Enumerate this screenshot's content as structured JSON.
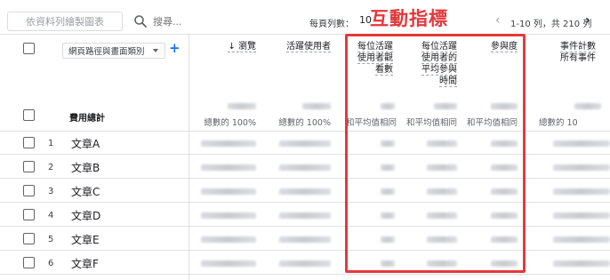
{
  "toolbar": {
    "chart_button_label": "依資料列繪製圖表",
    "search_placeholder": "搜尋...",
    "rows_per_page_label": "每頁列數：",
    "rows_per_page_value": "10",
    "pager_text": "1-10 列，共 210 列",
    "pager_prev": "‹",
    "pager_next": "›"
  },
  "annotation": {
    "title": "互動指標",
    "color": "#e5383b"
  },
  "dimension": {
    "selector_label": "網頁路徑與畫面類別",
    "add_symbol": "+"
  },
  "columns": [
    {
      "label": "↓ 瀏覽",
      "total_sub": "總數的 100%"
    },
    {
      "label": "活躍使用者",
      "total_sub": "總數的 100%"
    },
    {
      "label_lines": [
        "每位活躍",
        "使用者觀",
        "看數"
      ],
      "total_sub": "和平均值相同"
    },
    {
      "label_lines": [
        "每位活躍",
        "使用者的",
        "平均參與",
        "時間"
      ],
      "total_sub": "和平均值相同"
    },
    {
      "label": "參與度",
      "total_sub": "和平均值相同"
    },
    {
      "label": "事件計數",
      "label2": "所有事件",
      "total_sub": "總數的 10"
    }
  ],
  "total_row_label": "費用總計",
  "rows": [
    {
      "num": "1",
      "label": "文章A"
    },
    {
      "num": "2",
      "label": "文章B"
    },
    {
      "num": "3",
      "label": "文章C"
    },
    {
      "num": "4",
      "label": "文章D"
    },
    {
      "num": "5",
      "label": "文章E"
    },
    {
      "num": "6",
      "label": "文章F"
    }
  ],
  "icons": {
    "search": "search-icon",
    "dropdown": "chevron-down-icon",
    "add": "plus-icon",
    "sort": "arrow-down-icon"
  }
}
